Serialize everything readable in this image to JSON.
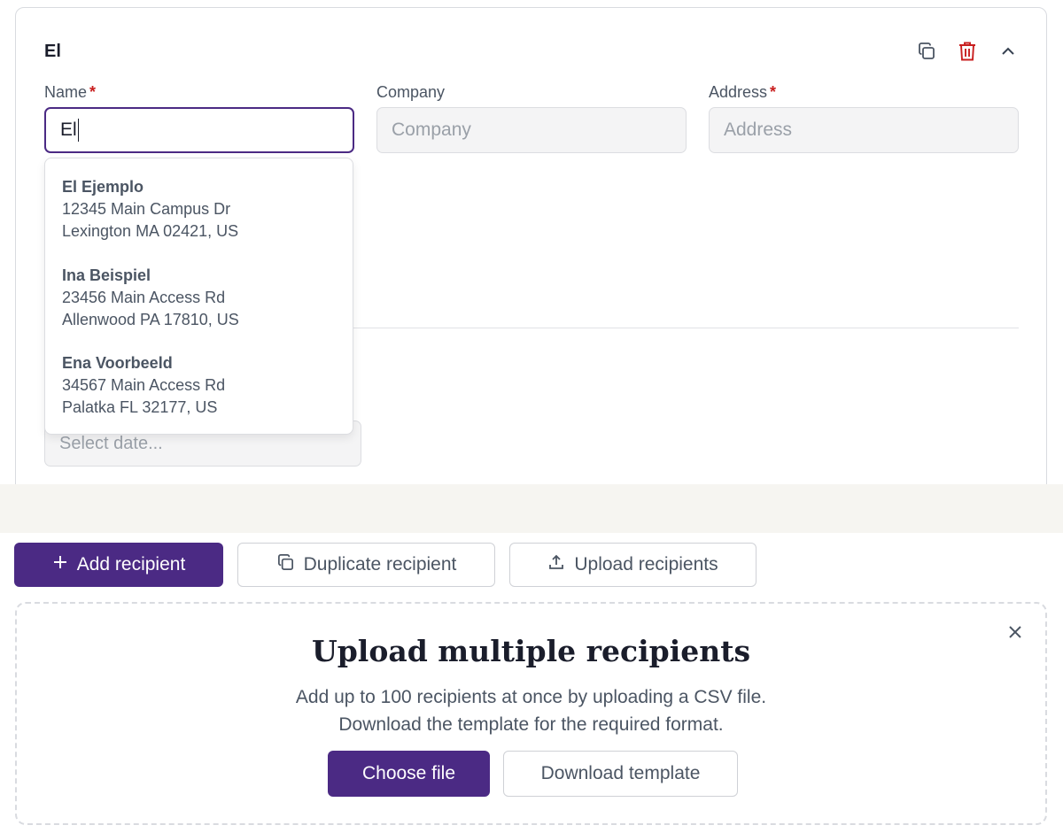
{
  "recipient_card": {
    "title": "El",
    "name_label": "Name",
    "name_value": "El",
    "company_label": "Company",
    "company_placeholder": "Company",
    "address_label": "Address",
    "address_placeholder": "Address",
    "required_mark": "*",
    "date_placeholder": "Select date..."
  },
  "suggestions": [
    {
      "name": "El Ejemplo",
      "line1": "12345 Main Campus Dr",
      "line2": "Lexington MA 02421, US"
    },
    {
      "name": "Ina Beispiel",
      "line1": "23456 Main Access Rd",
      "line2": "Allenwood PA 17810, US"
    },
    {
      "name": "Ena Voorbeeld",
      "line1": "34567 Main Access Rd",
      "line2": "Palatka FL 32177, US"
    }
  ],
  "actions": {
    "add_label": "Add recipient",
    "duplicate_label": "Duplicate recipient",
    "upload_label": "Upload recipients"
  },
  "upload_panel": {
    "title": "Upload multiple recipients",
    "desc_line1": "Add up to 100 recipients at once by uploading a CSV file.",
    "desc_line2": "Download the template for the required format.",
    "choose_label": "Choose file",
    "template_label": "Download template"
  },
  "colors": {
    "brand": "#4b2a84",
    "danger": "#c81e1e",
    "separator_band": "#f6f5f1"
  },
  "icons": [
    "duplicate-icon",
    "trash-icon",
    "chevron-up-icon",
    "plus-icon",
    "upload-icon",
    "close-icon"
  ]
}
